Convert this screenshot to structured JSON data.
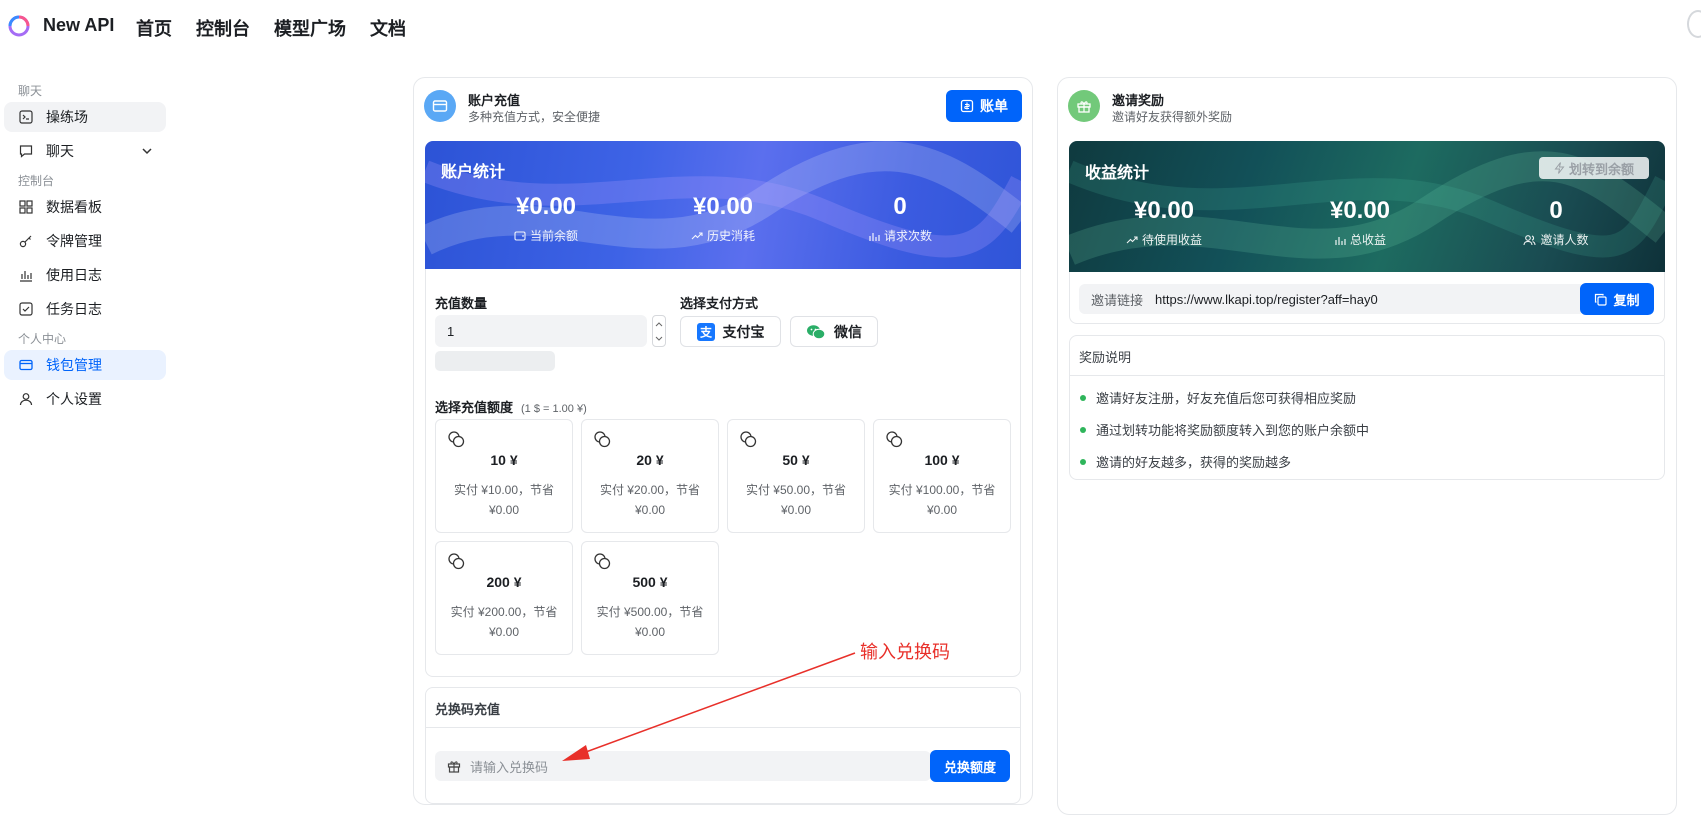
{
  "app": {
    "brand": "New API"
  },
  "nav": [
    "首页",
    "控制台",
    "模型广场",
    "文档"
  ],
  "sidebar": {
    "sections": [
      {
        "title": "聊天",
        "items": [
          {
            "label": "操练场",
            "icon": "terminal-icon"
          },
          {
            "label": "聊天",
            "icon": "message-icon"
          }
        ]
      },
      {
        "title": "控制台",
        "items": [
          {
            "label": "数据看板",
            "icon": "dashboard-icon"
          },
          {
            "label": "令牌管理",
            "icon": "key-icon"
          },
          {
            "label": "使用日志",
            "icon": "chart-icon"
          },
          {
            "label": "任务日志",
            "icon": "checkbox-icon"
          }
        ]
      },
      {
        "title": "个人中心",
        "items": [
          {
            "label": "钱包管理",
            "icon": "wallet-icon"
          },
          {
            "label": "个人设置",
            "icon": "user-icon"
          }
        ]
      }
    ]
  },
  "recharge": {
    "title": "账户充值",
    "subtitle": "多种充值方式，安全便捷",
    "bill_label": "账单",
    "stats_title": "账户统计",
    "stats": [
      {
        "value": "¥0.00",
        "label": "当前余额"
      },
      {
        "value": "¥0.00",
        "label": "历史消耗"
      },
      {
        "value": "0",
        "label": "请求次数"
      }
    ],
    "quantity_label": "充值数量",
    "quantity_value": "1",
    "payment_label": "选择支付方式",
    "payments": [
      "支付宝",
      "微信"
    ],
    "amount_label": "选择充值额度",
    "rate": "(1 $ = 1.00 ¥)",
    "options": [
      {
        "amount": "10 ¥",
        "desc": "实付 ¥10.00，节省 ¥0.00"
      },
      {
        "amount": "20 ¥",
        "desc": "实付 ¥20.00，节省 ¥0.00"
      },
      {
        "amount": "50 ¥",
        "desc": "实付 ¥50.00，节省 ¥0.00"
      },
      {
        "amount": "100 ¥",
        "desc": "实付 ¥100.00，节省 ¥0.00"
      },
      {
        "amount": "200 ¥",
        "desc": "实付 ¥200.00，节省 ¥0.00"
      },
      {
        "amount": "500 ¥",
        "desc": "实付 ¥500.00，节省 ¥0.00"
      }
    ],
    "redeem_title": "兑换码充值",
    "redeem_placeholder": "请输入兑换码",
    "redeem_button": "兑换额度"
  },
  "annotation": {
    "text": "输入兑换码",
    "color": "#e8302a"
  },
  "invite": {
    "title": "邀请奖励",
    "subtitle": "邀请好友获得额外奖励",
    "stats_title": "收益统计",
    "transfer_label": "划转到余额",
    "stats": [
      {
        "value": "¥0.00",
        "label": "待使用收益"
      },
      {
        "value": "¥0.00",
        "label": "总收益"
      },
      {
        "value": "0",
        "label": "邀请人数"
      }
    ],
    "link_label": "邀请链接",
    "link_value": "https://www.lkapi.top/register?aff=hay0",
    "copy_label": "复制",
    "rules_title": "奖励说明",
    "rules": [
      "邀请好友注册，好友充值后您可获得相应奖励",
      "通过划转功能将奖励额度转入到您的账户余额中",
      "邀请的好友越多，获得的奖励越多"
    ]
  },
  "colors": {
    "accent": "#0064fa",
    "green": "#2fb55b"
  }
}
